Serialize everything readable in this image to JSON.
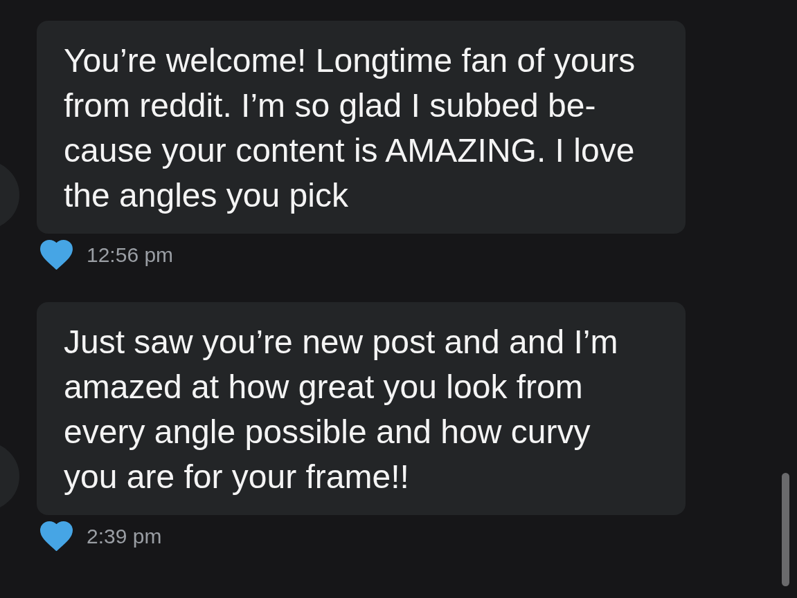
{
  "messages": [
    {
      "lines": [
        "You’re welcome! Longtime fan of yours",
        "from reddit. I’m so glad I subbed be-",
        "cause your content is AMAZING. I love",
        "the angles you pick"
      ],
      "liked": true,
      "time": "12:56 pm"
    },
    {
      "lines": [
        "Just saw you’re new post and and I’m",
        "amazed at how great you look from",
        "every angle possible and how curvy",
        "you are for your frame!!"
      ],
      "liked": true,
      "time": "2:39 pm"
    }
  ]
}
